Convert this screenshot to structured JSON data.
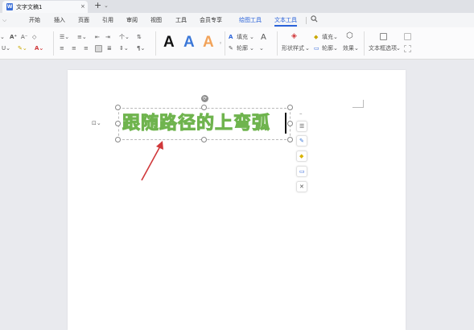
{
  "window": {
    "tab_title": "文字文稿1",
    "close_glyph": "×",
    "new_tab_glyph": "+",
    "tab_menu_glyph": "⌄"
  },
  "menu": {
    "items": [
      {
        "label": "开始"
      },
      {
        "label": "插入"
      },
      {
        "label": "页面"
      },
      {
        "label": "引用"
      },
      {
        "label": "审阅"
      },
      {
        "label": "视图"
      },
      {
        "label": "工具"
      },
      {
        "label": "会员专享"
      },
      {
        "label": "绘图工具",
        "highlight": true
      },
      {
        "label": "文本工具",
        "active": true
      }
    ]
  },
  "ribbon": {
    "text_styles": [
      "A",
      "A",
      "A"
    ],
    "text_style_colors": [
      "#111111",
      "#3c78d8",
      "#f2a35a"
    ],
    "fill_label": "填充",
    "outline_label": "轮廓",
    "shape_style_label": "形状样式",
    "fill2_label": "填充",
    "outline2_label": "轮廓",
    "effect_label": "效果",
    "text_direction_label": "文本框选项"
  },
  "canvas": {
    "word_art_text": "跟随路径的上弯弧",
    "word_art_fill": "#9fd684",
    "word_art_stroke": "#6fb44e",
    "arrow_color": "#d0383a"
  },
  "icons": {
    "doc": "document-icon",
    "search": "search-icon",
    "rotate": "rotate-handle-icon",
    "layout": "layout-options-icon",
    "side_tools": [
      "collapse-icon",
      "layout-icon",
      "pen-icon",
      "fill-icon",
      "outline-icon",
      "settings-icon"
    ]
  }
}
